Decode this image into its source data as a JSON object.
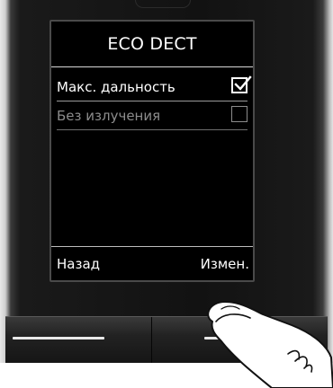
{
  "screen": {
    "title": "ECO DECT",
    "items": [
      {
        "label": "Макс. дальность",
        "checked": true,
        "state": "selected"
      },
      {
        "label": "Без излучения",
        "checked": false,
        "state": "unselected"
      }
    ],
    "softkeys": {
      "left": "Назад",
      "right": "Измен."
    }
  },
  "icons": {
    "checkbox_checked": "checkbox-checked-icon",
    "checkbox_unchecked": "checkbox-unchecked-icon",
    "hand": "pointing-finger-icon"
  },
  "colors": {
    "screen_bg": "#000000",
    "text_primary": "#ffffff",
    "text_disabled": "#8c8c8c",
    "phone_body": "#121212"
  }
}
